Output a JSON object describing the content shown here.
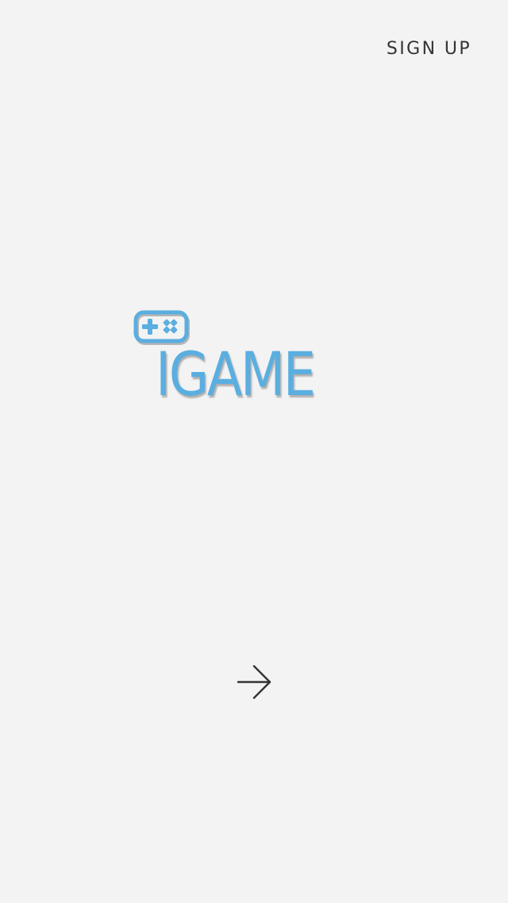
{
  "header": {
    "signup_label": "SIGN UP"
  },
  "logo": {
    "icon": "gamepad-icon",
    "text": "IGAME",
    "brand_color": "#5aaee0"
  },
  "navigation": {
    "next_icon": "arrow-right-icon"
  },
  "colors": {
    "background": "#f3f3f3",
    "text": "#333333"
  }
}
